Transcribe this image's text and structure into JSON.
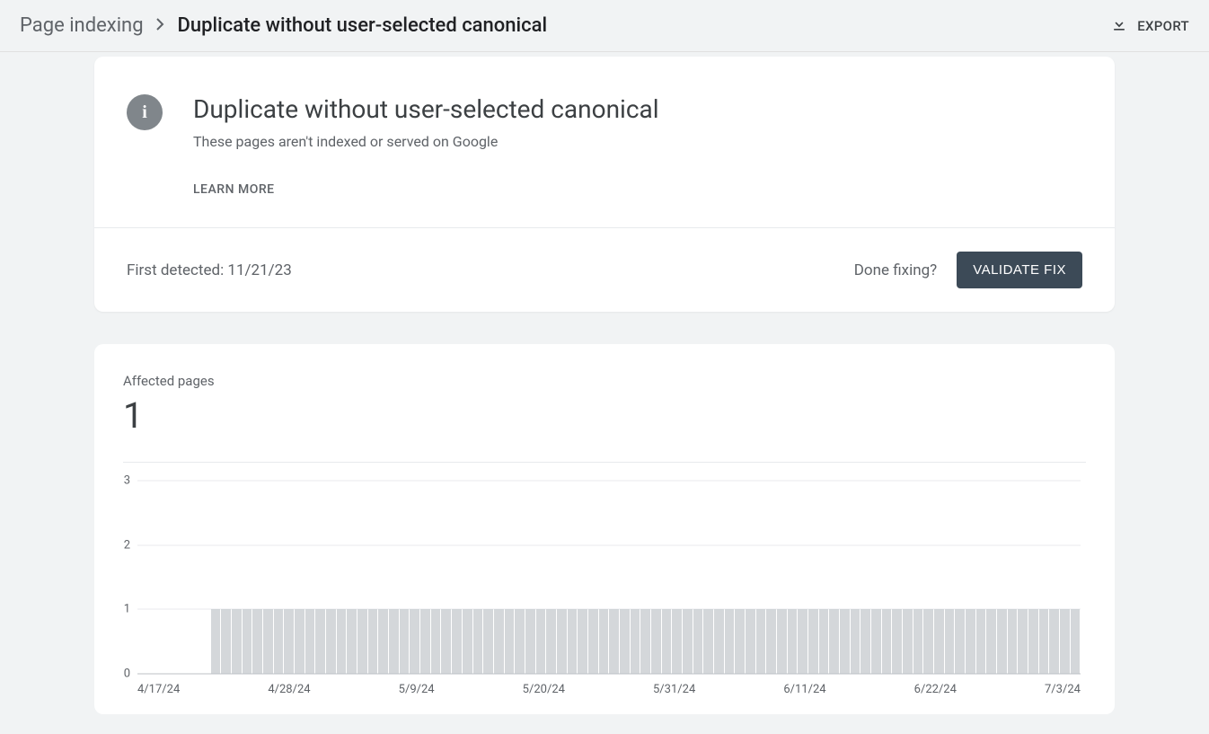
{
  "header": {
    "breadcrumb_root": "Page indexing",
    "breadcrumb_current": "Duplicate without user-selected canonical",
    "export_label": "EXPORT"
  },
  "issue_card": {
    "title": "Duplicate without user-selected canonical",
    "subtitle": "These pages aren't indexed or served on Google",
    "learn_more": "LEARN MORE",
    "first_detected_label": "First detected: ",
    "first_detected_date": "11/21/23",
    "done_fixing": "Done fixing?",
    "validate_button": "VALIDATE FIX"
  },
  "affected": {
    "label": "Affected pages",
    "value": "1"
  },
  "chart_data": {
    "type": "bar",
    "title": "Affected pages",
    "ylabel": "",
    "ylim": [
      0,
      3
    ],
    "yticks": [
      0,
      1,
      2,
      3
    ],
    "x_tick_labels": [
      "4/17/24",
      "4/28/24",
      "5/9/24",
      "5/20/24",
      "5/31/24",
      "6/11/24",
      "6/22/24",
      "7/3/24"
    ],
    "values": [
      0,
      0,
      0,
      0,
      0,
      0,
      0,
      1,
      1,
      1,
      1,
      1,
      1,
      1,
      1,
      1,
      1,
      1,
      1,
      1,
      1,
      1,
      1,
      1,
      1,
      1,
      1,
      1,
      1,
      1,
      1,
      1,
      1,
      1,
      1,
      1,
      1,
      1,
      1,
      1,
      1,
      1,
      1,
      1,
      1,
      1,
      1,
      1,
      1,
      1,
      1,
      1,
      1,
      1,
      1,
      1,
      1,
      1,
      1,
      1,
      1,
      1,
      1,
      1,
      1,
      1,
      1,
      1,
      1,
      1,
      1,
      1,
      1,
      1,
      1,
      1,
      1,
      1,
      1,
      1,
      1,
      1,
      1,
      1,
      1,
      1,
      1,
      1,
      1,
      1
    ]
  }
}
